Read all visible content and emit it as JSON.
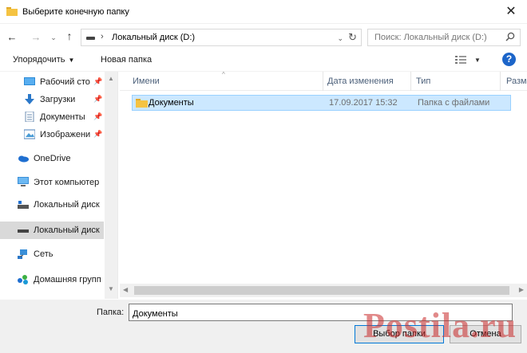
{
  "window": {
    "title": "Выберите конечную папку",
    "close_glyph": "✕"
  },
  "nav": {
    "back_glyph": "←",
    "forward_glyph": "→",
    "recent_glyph": "⌄",
    "up_glyph": "↑",
    "address_separator": "›",
    "address_path": "Локальный диск (D:)",
    "address_dropdown_glyph": "⌄",
    "refresh_glyph": "↻",
    "search_placeholder": "Поиск: Локальный диск (D:)"
  },
  "toolbar": {
    "organize_label": "Упорядочить",
    "organize_caret": "▼",
    "new_folder_label": "Новая папка",
    "view_dropdown_glyph": "▼",
    "help_label": "?"
  },
  "sidebar": {
    "pin_glyph": "📌",
    "items": [
      {
        "label": "Рабочий сто",
        "icon": "desktop-icon",
        "pinned": true
      },
      {
        "label": "Загрузки",
        "icon": "download-icon",
        "pinned": true
      },
      {
        "label": "Документы",
        "icon": "documents-icon",
        "pinned": true
      },
      {
        "label": "Изображени",
        "icon": "pictures-icon",
        "pinned": true
      },
      {
        "label": "OneDrive",
        "icon": "onedrive-icon",
        "pinned": false
      },
      {
        "label": "Этот компьютер",
        "icon": "computer-icon",
        "pinned": false
      },
      {
        "label": "Локальный диск",
        "icon": "drive-icon",
        "pinned": false
      },
      {
        "label": "Локальный диск",
        "icon": "drive-icon",
        "pinned": false,
        "selected": true
      },
      {
        "label": "Сеть",
        "icon": "network-icon",
        "pinned": false
      },
      {
        "label": "Домашняя групп",
        "icon": "homegroup-icon",
        "pinned": false
      }
    ],
    "scroll_up_glyph": "▲",
    "scroll_down_glyph": "▼"
  },
  "file_list": {
    "columns": [
      "Имени",
      "Дата изменения",
      "Тип",
      "Разм"
    ],
    "sort_glyph": "^",
    "rows": [
      {
        "name": "Документы",
        "date": "17.09.2017 15:32",
        "type": "Папка с файлами",
        "icon": "folder-icon"
      }
    ],
    "hscroll_left_glyph": "◀",
    "hscroll_right_glyph": "▶"
  },
  "footer": {
    "folder_label": "Папка:",
    "folder_value": "Документы",
    "select_button": "Выбор папки",
    "cancel_button": "Отмена"
  },
  "watermark": "Postila.ru",
  "colors": {
    "accent": "#0078d7",
    "selection_bg": "#cce8ff",
    "folder": "#f5c342",
    "help": "#1c65c9"
  }
}
